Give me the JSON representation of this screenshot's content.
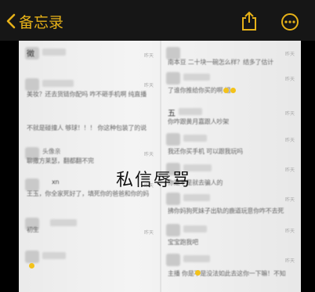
{
  "nav": {
    "back_label": "备忘录",
    "accent_color": "#e6b118",
    "back_icon": "chevron-left-icon",
    "share_icon": "share-icon",
    "more_icon": "more-icon"
  },
  "photo": {
    "caption": "私信辱骂",
    "left_column": [
      {
        "name": "徵",
        "message": "",
        "time": "昨天"
      },
      {
        "name": "",
        "message": "美妆？还去货链你配吗 咋不砸手机啊 纯直播",
        "time": "昨天"
      },
      {
        "name": "",
        "message": "不就是碰撞人 够球！！！ 你这种包装了的说",
        "time": ""
      },
      {
        "name": "头像亲",
        "message": "聊撒方莱瑟，翻都翻不完",
        "time": "昨天"
      },
      {
        "name": "xn",
        "message": "王玉，你全家死好了，填死你的爸爸和你的妈",
        "time": "昨天"
      },
      {
        "name": "",
        "message": "初生",
        "time": "昨天"
      },
      {
        "name": "",
        "message": "",
        "time": ""
      }
    ],
    "right_column": [
      {
        "name": "",
        "message": "南本豆 二十块一碗怎么样？结多了估计",
        "time": "昨天"
      },
      {
        "name": "",
        "message": "了谁你推给你买的啊 姐",
        "time": "昨天"
      },
      {
        "name": "五",
        "message": "你咋跟黄月嘉跟人吵架",
        "time": "昨天"
      },
      {
        "name": "",
        "message": "我还你买手机 可以跟我玩吗",
        "time": "昨天"
      },
      {
        "name": "",
        "message": "你是不是就去骗人的",
        "time": "昨天"
      },
      {
        "name": "",
        "message": "拂你妈狗死妹子出轨的鹿道玩意你咋不去死",
        "time": "昨天"
      },
      {
        "name": "",
        "message": "宝宝跑我吧",
        "time": "昨天"
      },
      {
        "name": "",
        "message": "主播 你是不是没法如此去这你一下嘛！不知",
        "time": "昨天"
      }
    ]
  }
}
